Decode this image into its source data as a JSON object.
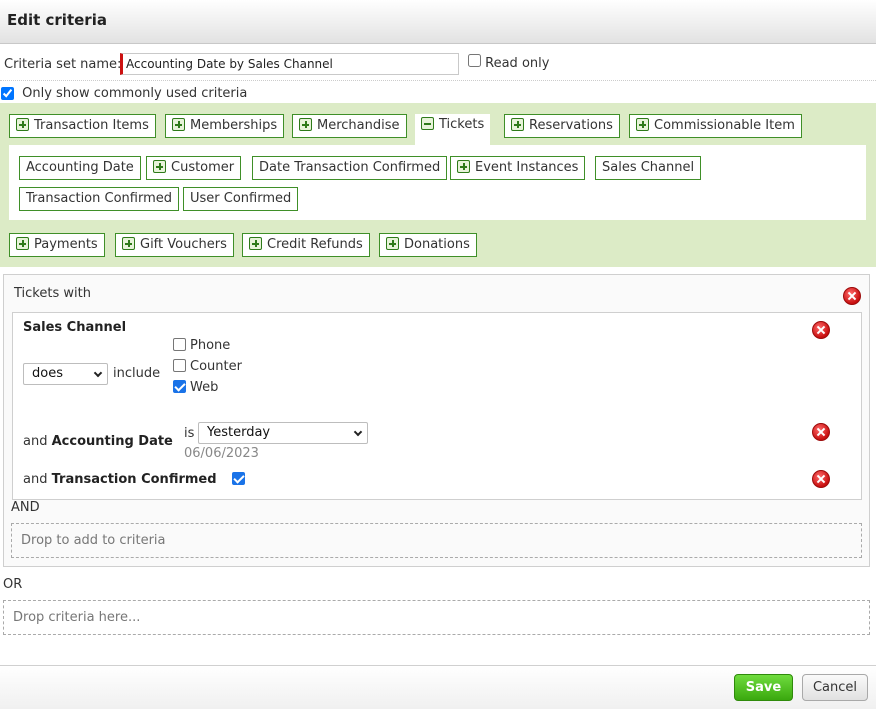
{
  "dialog": {
    "title": "Edit criteria"
  },
  "criteria_set": {
    "label": "Criteria set name:",
    "value": "Accounting Date by Sales Channel",
    "read_only_label": "Read only",
    "read_only_checked": false
  },
  "common": {
    "label": "Only show commonly used criteria",
    "checked": true
  },
  "categories": {
    "transaction_items": "Transaction Items",
    "memberships": "Memberships",
    "merchandise": "Merchandise",
    "tickets": "Tickets",
    "reservations": "Reservations",
    "commissionable_item": "Commissionable Item",
    "payments": "Payments",
    "gift_vouchers": "Gift Vouchers",
    "credit_refunds": "Credit Refunds",
    "donations": "Donations"
  },
  "ticket_fields": {
    "accounting_date": "Accounting Date",
    "customer": "Customer",
    "date_transaction_confirmed": "Date Transaction Confirmed",
    "event_instances": "Event Instances",
    "sales_channel": "Sales Channel",
    "transaction_confirmed": "Transaction Confirmed",
    "user_confirmed": "User Confirmed"
  },
  "group": {
    "heading": "Tickets with",
    "sales_channel": {
      "label": "Sales Channel",
      "operator": "does",
      "verb": "include",
      "options": [
        {
          "label": "Phone",
          "checked": false
        },
        {
          "label": "Counter",
          "checked": false
        },
        {
          "label": "Web",
          "checked": true
        }
      ]
    },
    "accounting_date": {
      "prefix": "and",
      "label": "Accounting Date",
      "verb": "is",
      "value": "Yesterday",
      "resolved_date": "06/06/2023"
    },
    "transaction_confirmed": {
      "prefix": "and",
      "label": "Transaction Confirmed",
      "checked": true
    },
    "and_label": "AND",
    "and_drop": "Drop to add to criteria"
  },
  "or_label": "OR",
  "or_drop": "Drop criteria here...",
  "buttons": {
    "save": "Save",
    "cancel": "Cancel"
  },
  "colors": {
    "accent_green": "#3aa80e",
    "chip_border": "#3f8f28",
    "panel_green": "#dcebc6",
    "remove_red": "#c80f0f",
    "required_red": "#cc1111"
  }
}
